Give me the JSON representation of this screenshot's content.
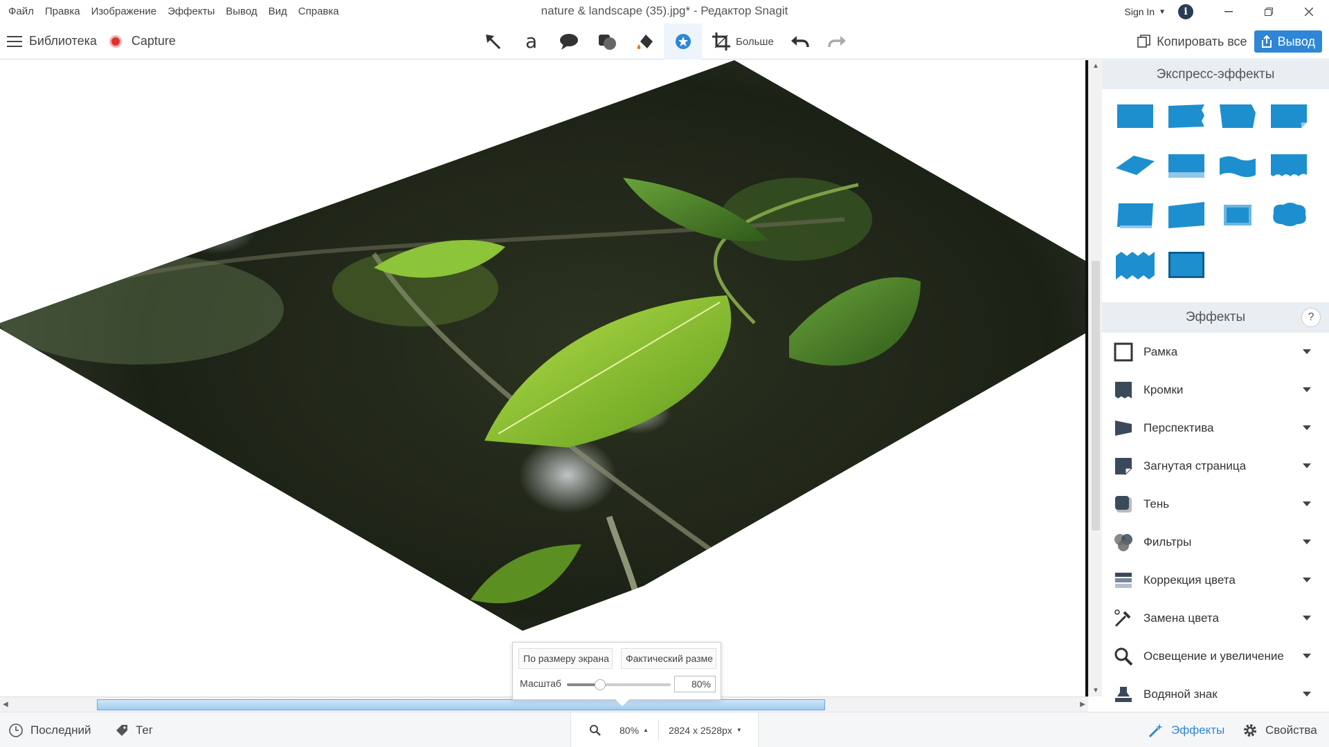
{
  "menu": [
    "Файл",
    "Правка",
    "Изображение",
    "Эффекты",
    "Вывод",
    "Вид",
    "Справка"
  ],
  "window_title": "nature & landscape (35).jpg* - Редактор Snagit",
  "account": {
    "sign_in": "Sign In"
  },
  "toolbar": {
    "library": "Библиотека",
    "capture": "Capture",
    "tools": [
      "arrow-tool",
      "text-tool",
      "callout-tool",
      "shape-tool",
      "fill-tool",
      "effects-tool",
      "crop-tool"
    ],
    "active_tool": "effects-tool",
    "more": "Больше",
    "copy_all": "Копировать все",
    "output": "Вывод"
  },
  "zoom_popup": {
    "fit_screen": "По размеру экрана",
    "actual_size": "Фактический разме",
    "scale_label": "Масштаб",
    "scale_value": "80%",
    "slider_fraction": 0.32
  },
  "panel": {
    "quick_effects_title": "Экспресс-эффекты",
    "quick_effects_count": 14,
    "effects_title": "Эффекты",
    "help": "?",
    "effects": [
      {
        "label": "Рамка",
        "icon": "border-icon"
      },
      {
        "label": "Кромки",
        "icon": "edges-icon"
      },
      {
        "label": "Перспектива",
        "icon": "perspective-icon"
      },
      {
        "label": "Загнутая страница",
        "icon": "page-curl-icon"
      },
      {
        "label": "Тень",
        "icon": "shadow-icon"
      },
      {
        "label": "Фильтры",
        "icon": "filters-icon"
      },
      {
        "label": "Коррекция цвета",
        "icon": "color-adjust-icon"
      },
      {
        "label": "Замена цвета",
        "icon": "color-replace-icon"
      },
      {
        "label": "Освещение и увеличение",
        "icon": "spotlight-magnify-icon"
      },
      {
        "label": "Водяной знак",
        "icon": "watermark-icon"
      }
    ]
  },
  "statusbar": {
    "recent": "Последний",
    "tag": "Тег",
    "zoom": "80%",
    "dimensions": "2824 x 2528px",
    "effects": "Эффекты",
    "properties": "Свойства"
  },
  "colors": {
    "accent": "#2f86d6",
    "record": "#e0302c",
    "quick_effect": "#1d8fcf"
  }
}
